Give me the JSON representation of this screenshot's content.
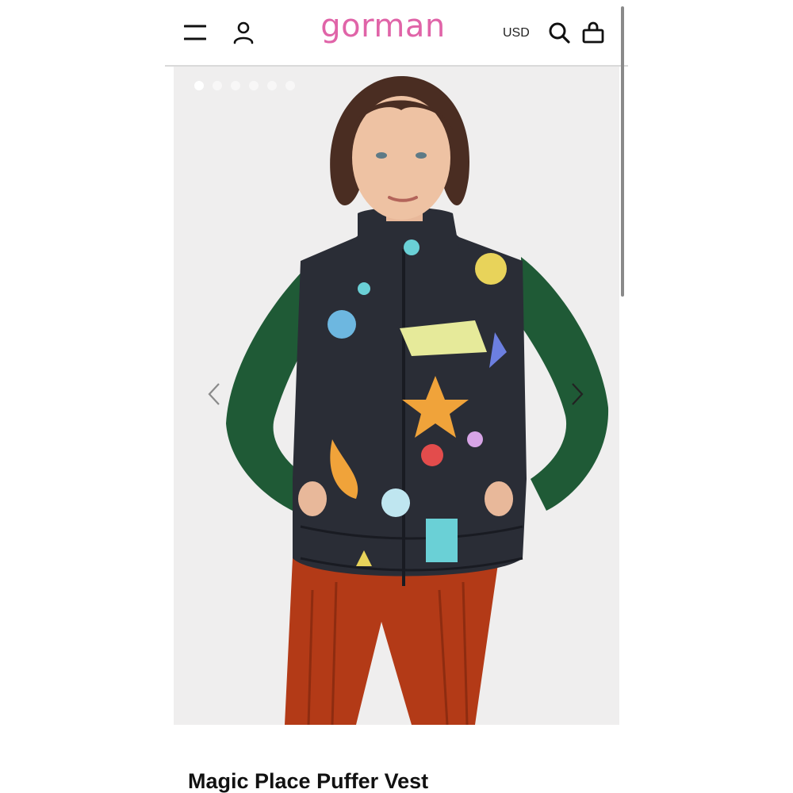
{
  "header": {
    "logo": "gorman",
    "currency": "USD",
    "icons": [
      "menu-icon",
      "account-icon",
      "search-icon",
      "bag-icon"
    ]
  },
  "gallery": {
    "slide_count": 6,
    "active_slide": 1,
    "image_description_colors": {
      "background": "#efeeee",
      "vest": "#2a2d36",
      "sleeves": "#1f5a36",
      "pants": "#b33a17"
    }
  },
  "product": {
    "title": "Magic Place Puffer Vest"
  },
  "theme": {
    "brand": "#e064a8",
    "text": "#111111"
  }
}
